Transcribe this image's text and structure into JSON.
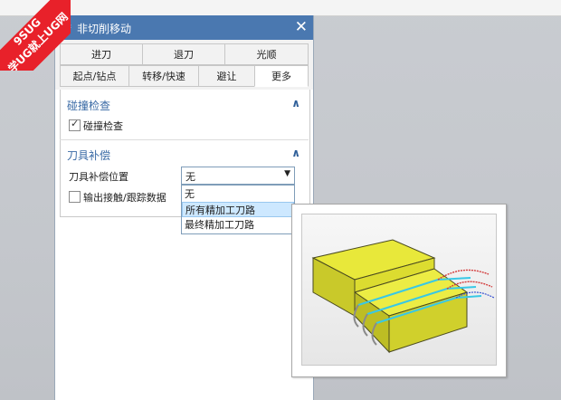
{
  "watermark": {
    "line1": "9SUG",
    "line2": "学UG就上UG网"
  },
  "dialog": {
    "title": "非切削移动",
    "tabs_row1": [
      "进刀",
      "退刀",
      "光顺"
    ],
    "tabs_row2": [
      "起点/钻点",
      "转移/快速",
      "避让",
      "更多"
    ],
    "section_collision": {
      "title": "碰撞检查",
      "checkbox_label": "碰撞检查",
      "checked": true
    },
    "section_comp": {
      "title": "刀具补偿",
      "position_label": "刀具补偿位置",
      "selected_value": "无",
      "options": [
        "无",
        "所有精加工刀路",
        "最终精加工刀路"
      ],
      "highlighted_index": 1,
      "output_label": "输出接触/跟踪数据",
      "output_checked": false
    }
  },
  "colors": {
    "titlebar": "#4a78b0",
    "section": "#3a6aa5",
    "highlight": "#cde8ff"
  },
  "icons": {
    "gear": "gear-icon",
    "close": "close-icon",
    "chevron": "chevron-up-icon",
    "dropdown": "dropdown-arrow-icon"
  }
}
